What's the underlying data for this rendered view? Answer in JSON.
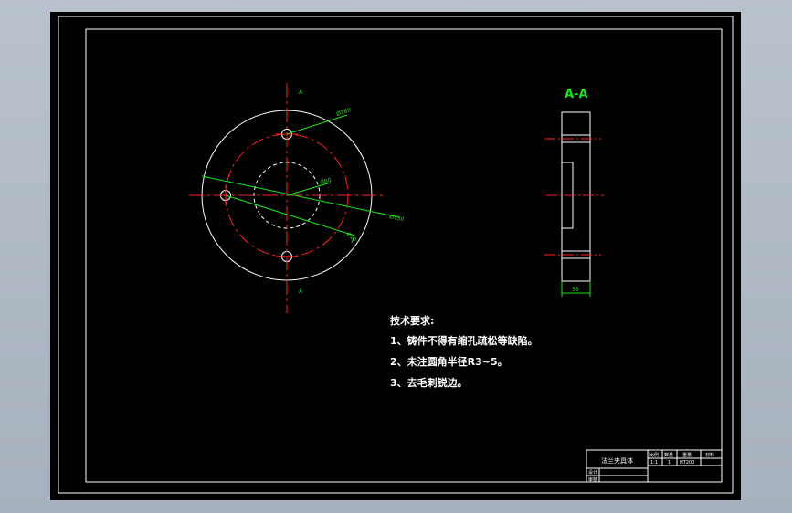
{
  "drawing": {
    "section_label": "A-A",
    "cut_mark_top": "A",
    "cut_mark_bottom": "A",
    "dim_outer": "Ø180",
    "dim_bolt_circle": "Ø130",
    "dim_bore": "Ø80",
    "dim_hole": "Ø10",
    "dim_thickness": "35",
    "colors": {
      "background": "#000000",
      "outline": "#ffffff",
      "centerline": "#ff2020",
      "dimension": "#19e619"
    }
  },
  "notes": {
    "title": "技术要求:",
    "line1": "1、铸件不得有缩孔疏松等缺陷。",
    "line2": "2、未注圆角半径R3~5。",
    "line3": "3、去毛刺锐边。"
  },
  "title_block": {
    "part_name": "法兰夹具体",
    "col_scale": "比例",
    "col_qty": "数量",
    "col_weight": "重量",
    "col_material": "材料",
    "scale_value": "1:1",
    "qty_value": "1",
    "material_value": "HT200",
    "designer": "设计",
    "checker": "审核"
  }
}
